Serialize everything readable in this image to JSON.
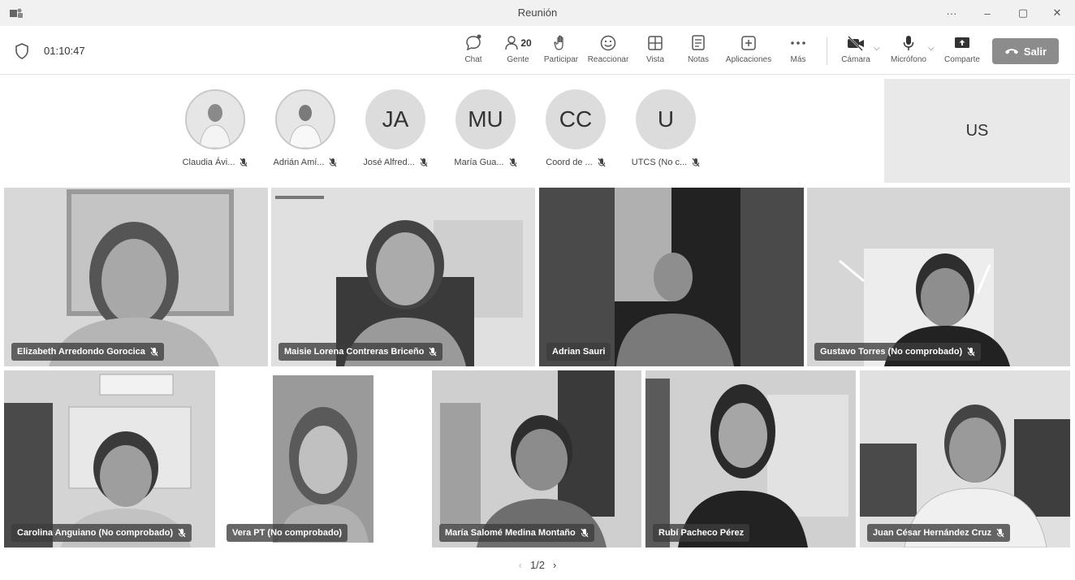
{
  "window": {
    "title": "Reunión",
    "more": "···",
    "minimize": "–",
    "restore": "▢",
    "close": "✕"
  },
  "toolbar": {
    "timer": "01:10:47",
    "chat": "Chat",
    "people": "Gente",
    "people_count": "20",
    "raise": "Participar",
    "react": "Reaccionar",
    "view": "Vista",
    "notes": "Notas",
    "apps": "Aplicaciones",
    "more": "Más",
    "camera": "Cámara",
    "mic": "Micrófono",
    "share": "Comparte",
    "leave": "Salir"
  },
  "strip": {
    "participants": [
      {
        "name": "Claudia Ávi...",
        "initials": ""
      },
      {
        "name": "Adrián Amí...",
        "initials": ""
      },
      {
        "name": "José Alfred...",
        "initials": "JA"
      },
      {
        "name": "María Gua...",
        "initials": "MU"
      },
      {
        "name": "Coord de ...",
        "initials": "CC"
      },
      {
        "name": "UTCS (No c...",
        "initials": "U"
      }
    ],
    "self_initials": "US"
  },
  "tiles": [
    {
      "name": "Elizabeth Arredondo Gorocica"
    },
    {
      "name": "Maisie Lorena Contreras Briceño"
    },
    {
      "name": "Adrian Sauri"
    },
    {
      "name": "Gustavo Torres (No comprobado)"
    },
    {
      "name": "Carolina Anguiano (No comprobado)"
    },
    {
      "name": "Vera PT (No comprobado)"
    },
    {
      "name": "María Salomé Medina Montaño"
    },
    {
      "name": "Rubí Pacheco Pérez"
    },
    {
      "name": "Juan César Hernández Cruz"
    }
  ],
  "pager": {
    "label": "1/2"
  },
  "colors": {
    "leave_button": "#8c8c8c",
    "titlebar": "#f1f1f1",
    "tile_label": "#3c3c3c"
  }
}
